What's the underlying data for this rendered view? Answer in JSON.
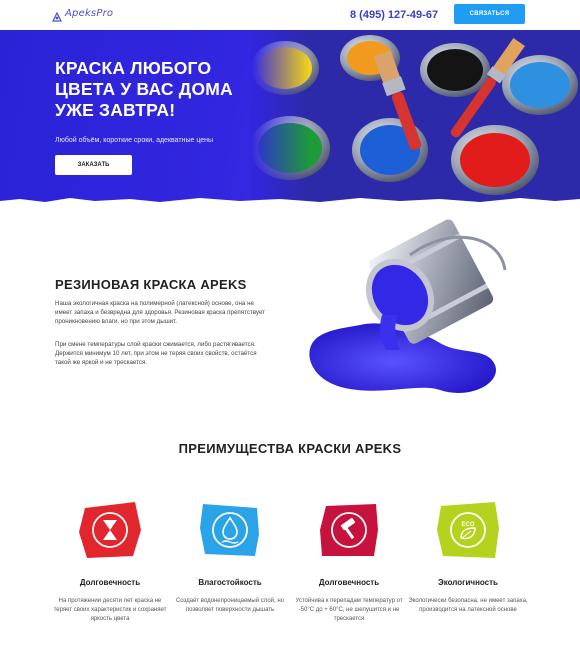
{
  "header": {
    "logo_text": "ApeksPro",
    "phone": "8 (495) 127-49-67",
    "contact_label": "СВЯЗАТЬСЯ"
  },
  "hero": {
    "title": "КРАСКА ЛЮБОГО ЦВЕТА У ВАС ДОМА УЖЕ ЗАВТРА!",
    "subtitle": "Любой объём, короткие сроки, адекватные цены",
    "order_label": "ЗАКАЗАТЬ"
  },
  "about": {
    "title": "РЕЗИНОВАЯ КРАСКА APEKS",
    "paragraph1": "Наша экологичная краска на полимерной (латексной) основе, она не имеет запаха и безвредна для здоровья. Резиновая краска препятствует проникновению влаги, но при этом дышит.",
    "paragraph2": "При смене температуры слой краски сжимается, либо растягивается. Держится минимум 10 лет, при этом не теряя своих свойств, остаётся такой же яркой и не трескается."
  },
  "advantages": {
    "title": "ПРЕИМУЩЕСТВА КРАСКИ APEKS",
    "items": [
      {
        "name": "Долговечность",
        "desc": "На протяжении десяти лет краска не теряет своих характеристик и сохраняет яркость цвета",
        "icon": "hourglass-icon",
        "color": "#e2262d"
      },
      {
        "name": "Влагостойкость",
        "desc": "Создаёт водонепроницаемый слой, но позволяет поверхности дышать",
        "icon": "water-drop-icon",
        "color": "#2aa3e8"
      },
      {
        "name": "Долговечность",
        "desc": "Устойчива к перепадам температур от -50°C до + 60°C, не шелушится и не трескается",
        "icon": "hammer-icon",
        "color": "#c8123e"
      },
      {
        "name": "Экологичность",
        "desc": "Экологически безопасна, не имеет запаха, производится на латексной основе",
        "icon": "eco-leaf-icon",
        "color": "#b5d21e"
      }
    ]
  },
  "colors": {
    "brand_blue": "#3226e0",
    "contact_button": "#1e9df2",
    "phone_text": "#3b3fc7"
  }
}
